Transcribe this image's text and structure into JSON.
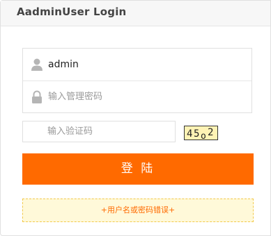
{
  "header": {
    "title": "AadminUser Login"
  },
  "form": {
    "username": {
      "value": "admin",
      "icon": "user-icon"
    },
    "password": {
      "placeholder": "输入管理密码",
      "icon": "lock-icon"
    },
    "captcha": {
      "placeholder": "输入验证码",
      "image_text": "45o2"
    },
    "submit_label": "登 陆",
    "error_message": "+用户名或密码错误+"
  },
  "colors": {
    "accent": "#ff6a00",
    "error_bg": "#fff9d9",
    "error_border": "#f2c94c",
    "captcha_bg": "#fff3b5"
  }
}
